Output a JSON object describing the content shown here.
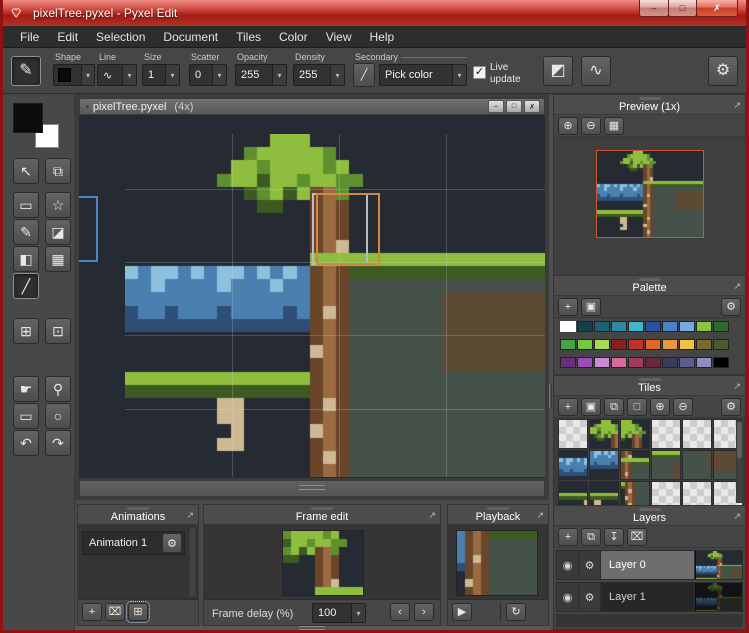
{
  "window": {
    "title": "pixelTree.pyxel - Pyxel Edit"
  },
  "icons": {
    "heart": "♥",
    "minimize": "–",
    "maximize": "□",
    "close": "✗",
    "bullet": "▪",
    "doc_min": "–",
    "doc_max": "□",
    "doc_close": "✗",
    "pencil": "✎",
    "arrow": "▾",
    "check": "✓",
    "eyedropper": "╱",
    "mask": "◩",
    "curve": "∿",
    "gear": "⚙",
    "popout": "↗",
    "eye": "◉",
    "play": "▶",
    "loop": "↻",
    "prev": "‹",
    "next": "›"
  },
  "menu": {
    "items": [
      "File",
      "Edit",
      "Selection",
      "Document",
      "Tiles",
      "Color",
      "View",
      "Help"
    ]
  },
  "toolbar": {
    "shape_label": "Shape",
    "line_label": "Line",
    "size_label": "Size",
    "size_value": "1",
    "scatter_label": "Scatter",
    "scatter_value": "0",
    "opacity_label": "Opacity",
    "opacity_value": "255",
    "density_label": "Density",
    "density_value": "255",
    "secondary_label": "Secondary",
    "pick_color": "Pick color",
    "live_update": "Live update"
  },
  "left_tools": [
    [
      {
        "name": "move-tool-button",
        "icon_name": "move-icon",
        "icon": "↖"
      },
      {
        "name": "transform-tool-button",
        "icon_name": "transform-icon",
        "icon": "⧉"
      }
    ],
    [
      {
        "name": "select-rect-tool-button",
        "icon_name": "selection-icon",
        "icon": "▭"
      },
      {
        "name": "magic-wand-tool-button",
        "icon_name": "wand-icon",
        "icon": "☆"
      }
    ],
    [
      {
        "name": "pencil-tool-button",
        "icon_name": "pencil-icon",
        "icon": "✎"
      },
      {
        "name": "eraser-tool-button",
        "icon_name": "eraser-icon",
        "icon": "◪"
      }
    ],
    [
      {
        "name": "fill-tool-button",
        "icon_name": "fill-icon",
        "icon": "◧"
      },
      {
        "name": "pattern-tool-button",
        "icon_name": "pattern-icon",
        "icon": "▦"
      }
    ],
    [
      {
        "name": "eyedropper-tool-button",
        "icon_name": "eyedropper-icon",
        "icon": "╱",
        "active": true
      }
    ],
    [
      {
        "name": "tile-place-tool-button",
        "icon_name": "tile-icon",
        "icon": "⊞"
      },
      {
        "name": "tile-settings-button",
        "icon_name": "tile-gear-icon",
        "icon": "⊡"
      }
    ],
    [
      {
        "name": "hand-tool-button",
        "icon_name": "hand-icon",
        "icon": "☛"
      },
      {
        "name": "zoom-tool-button",
        "icon_name": "magnifier-icon",
        "icon": "⚲"
      }
    ],
    [
      {
        "name": "rect-shape-tool-button",
        "icon_name": "rectangle-icon",
        "icon": "▭"
      },
      {
        "name": "ellipse-shape-tool-button",
        "icon_name": "ellipse-icon",
        "icon": "○"
      }
    ],
    [
      {
        "name": "undo-button",
        "icon_name": "undo-icon",
        "icon": "↶"
      },
      {
        "name": "redo-button",
        "icon_name": "redo-icon",
        "icon": "↷"
      }
    ]
  ],
  "document_tab": {
    "title": "pixelTree.pyxel",
    "zoom": "(4x)"
  },
  "canvas_art": {
    "palette": {
      ".": "#262b33",
      "G": "#8fbe3f",
      "g": "#5e9030",
      "d": "#3c5a22",
      "T": "#9a6b40",
      "t": "#6a452a",
      "W": "#8cc0dd",
      "w": "#4a80b0",
      "n": "#2d4f78",
      "E": "#44524a",
      "B": "#5d4a35",
      "s": "#cdb992",
      "k": "#1b2025"
    },
    "rows": [
      "...........GGG..................",
      ".........gGGGGGg................",
      "........GGgGGGGgG...............",
      ".......gGGdGGgGGgg..............",
      ".........dgGdGtTg...............",
      "..........dd..tTt...............",
      "..............tTt...............",
      "..............tTt...............",
      "..............tTs...............",
      "..............GGGGGGGGGGGGGGGGGG",
      "WwWWwWwWWwWwWwtTtddddddddddddddd",
      "wwWwwwwWwwwWwwtTtEEEEEEEEEEEEEEE",
      "wwwwwwwwwwwwwwtTtEEEEEEEBBBBBBBB",
      "nwwnwwwnwwwwnwtstEEEEEEEBBBBBBBB",
      "nnnnnnnnnnnnnntTtEEEEEEEBBBBBBBB",
      "..............tTtEEEEEEEBBBBBBBB",
      "..............sTtEEEEEEEBBBBBBBB",
      "..............tTtEEEEEEEBBBBBBBB",
      "GGGGGGGGGGGGGGtTtEEEEEEEEEEEEEEE",
      "ddddddddddddddtTtEEEEEEEEEEEEEEE",
      ".......ss.....tstEEEEEEEEEEEEEEE",
      ".......ss.....tTtEEEEEEEEEEEEEEE",
      "........s.....sTtEEEEEEEEEEEEEEE",
      ".......ss.....tTtEEEEEEEEEEEEEEE",
      "..............tstEEEEEEEEEEEEEEE",
      "..............tTtEEEEEEEEEEEEEEE"
    ]
  },
  "panels": {
    "preview": {
      "title": "Preview (1x)",
      "buttons": [
        {
          "name": "preview-zoom-in-button",
          "icon_name": "zoom-in-icon",
          "icon": "⊕"
        },
        {
          "name": "preview-zoom-out-button",
          "icon_name": "zoom-out-icon",
          "icon": "⊖"
        },
        {
          "name": "preview-background-toggle",
          "icon_name": "checker-icon",
          "icon": "▦"
        }
      ]
    },
    "palette": {
      "title": "Palette",
      "buttons": [
        {
          "name": "palette-add-color-button",
          "icon_name": "plus-icon",
          "icon": "+"
        },
        {
          "name": "palette-fill-button",
          "icon_name": "bucket-icon",
          "icon": "▣"
        },
        {
          "name": "palette-settings-button",
          "icon_name": "gear-icon",
          "icon": "⚙",
          "align": "right"
        }
      ],
      "selected_index": 0,
      "colors": [
        "#ffffff",
        "#0e1b26",
        "#15404e",
        "#1e6272",
        "#2a8ba1",
        "#45b5cc",
        "#2a52a4",
        "#4a82c8",
        "#74acdf",
        "#8cc63e",
        "#2d6b2d",
        "#47a347",
        "#72cb3a",
        "#a5dc55",
        "#8a1f1f",
        "#c23326",
        "#e2662a",
        "#ea973e",
        "#f2c244",
        "#7a6a2a",
        "#4a5a28",
        "#6a2d7c",
        "#9c4cb4",
        "#ca8cda",
        "#d96a9c",
        "#a23a5c",
        "#6a2a3c",
        "#3a3a5c",
        "#5c5c8e",
        "#8e8ebe",
        "#000000",
        "#2e2e2e",
        "#5a5a5a",
        "#8a8a8a",
        "#bcbcbc",
        "#ffffff",
        "#5c4a3a",
        "#8e6c4a",
        "#c29a7a",
        "#e2caa8"
      ]
    },
    "tiles": {
      "title": "Tiles",
      "buttons": [
        {
          "name": "tiles-add-button",
          "icon_name": "plus-icon",
          "icon": "+"
        },
        {
          "name": "tiles-fill-button",
          "icon_name": "bucket-icon",
          "icon": "▣"
        },
        {
          "name": "tiles-duplicate-button",
          "icon_name": "duplicate-icon",
          "icon": "⧉"
        },
        {
          "name": "tiles-clear-button",
          "icon_name": "empty-tile-icon",
          "icon": "□"
        },
        {
          "name": "tiles-zoom-in-button",
          "icon_name": "zoom-in-icon",
          "icon": "⊕"
        },
        {
          "name": "tiles-zoom-out-button",
          "icon_name": "zoom-out-icon",
          "icon": "⊖"
        },
        {
          "name": "tiles-settings-button",
          "icon_name": "gear-icon",
          "icon": "⚙",
          "align": "right"
        }
      ],
      "grid": [
        {
          "t": "c"
        },
        {
          "t": "s",
          "r": 0,
          "c": 8
        },
        {
          "t": "s",
          "r": 0,
          "c": 11
        },
        {
          "t": "c"
        },
        {
          "t": "c"
        },
        {
          "t": "c"
        },
        {
          "t": "s",
          "r": 8,
          "c": 0
        },
        {
          "t": "s",
          "r": 10,
          "c": 6
        },
        {
          "t": "s",
          "r": 7,
          "c": 14
        },
        {
          "t": "s",
          "r": 9,
          "c": 18
        },
        {
          "t": "s",
          "r": 12,
          "c": 17
        },
        {
          "t": "s",
          "r": 12,
          "c": 24
        },
        {
          "t": "s",
          "r": 15,
          "c": 0
        },
        {
          "t": "s",
          "r": 15,
          "c": 6
        },
        {
          "t": "s",
          "r": 18,
          "c": 13
        },
        {
          "t": "c"
        },
        {
          "t": "c"
        },
        {
          "t": "c"
        }
      ]
    },
    "layers": {
      "title": "Layers",
      "buttons": [
        {
          "name": "layers-add-button",
          "icon_name": "plus-icon",
          "icon": "+"
        },
        {
          "name": "layers-duplicate-button",
          "icon_name": "duplicate-icon",
          "icon": "⧉"
        },
        {
          "name": "layers-merge-button",
          "icon_name": "merge-down-icon",
          "icon": "↧"
        },
        {
          "name": "layers-delete-button",
          "icon_name": "trash-icon",
          "icon": "⌧"
        }
      ],
      "rows": [
        {
          "name": "Layer 0"
        },
        {
          "name": "Layer 1"
        }
      ]
    },
    "animations": {
      "title": "Animations",
      "items": [
        "Animation 1"
      ],
      "buttons": [
        {
          "name": "animation-add-button",
          "icon_name": "plus-icon",
          "icon": "+"
        },
        {
          "name": "animation-delete-button",
          "icon_name": "trash-icon",
          "icon": "⌧"
        },
        {
          "name": "animation-pick-tiles-button",
          "icon_name": "grid-cursor-icon",
          "icon": "⊞",
          "focus": true
        }
      ]
    },
    "frame_edit": {
      "title": "Frame edit",
      "frame_delay_label": "Frame delay (%)",
      "frame_delay_value": "100"
    },
    "playback": {
      "title": "Playback"
    }
  }
}
